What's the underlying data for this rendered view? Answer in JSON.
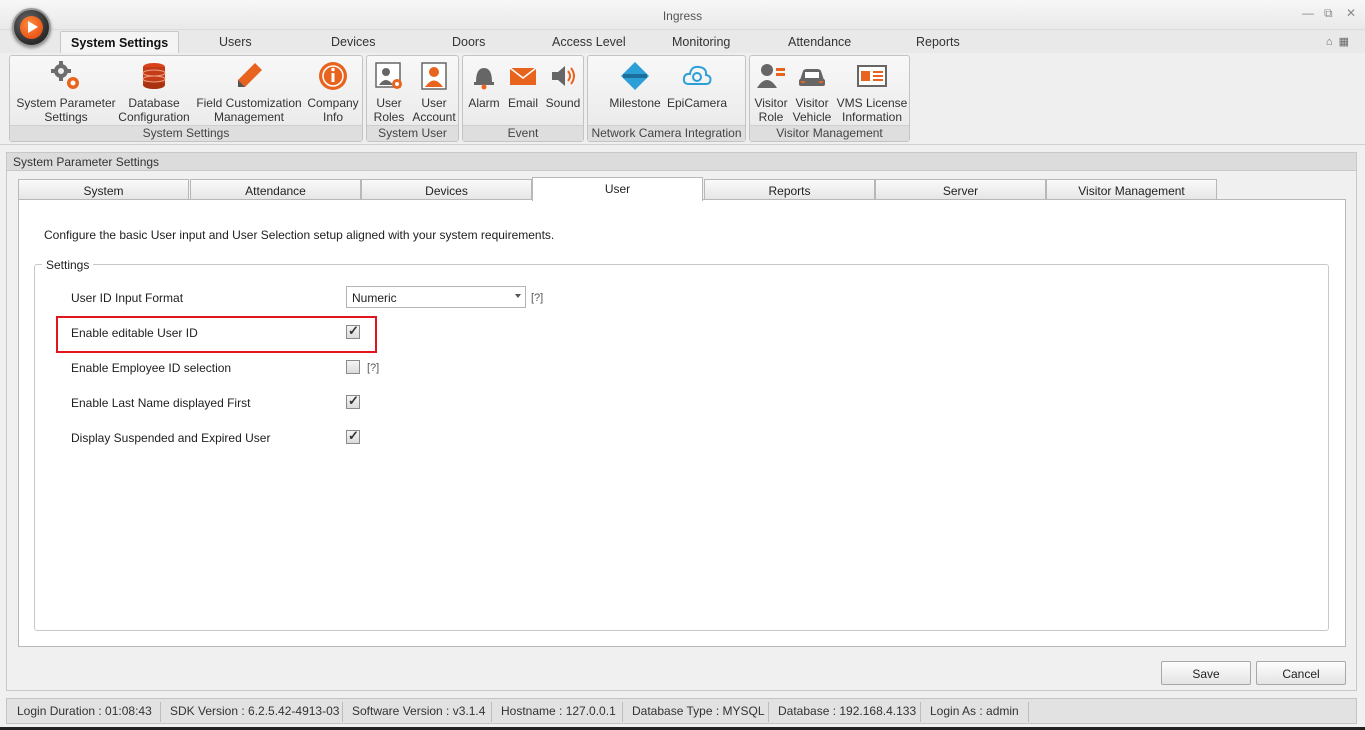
{
  "window": {
    "title": "Ingress",
    "controls": [
      "_",
      "▭",
      "▫"
    ]
  },
  "menu": {
    "tabs": [
      "System Settings",
      "Users",
      "Devices",
      "Doors",
      "Access Level",
      "Monitoring",
      "Attendance",
      "Reports"
    ],
    "active": "System Settings"
  },
  "ribbon": {
    "groups": [
      {
        "caption": "System Settings",
        "buttons": [
          {
            "label": "System Parameter\nSettings",
            "icon": "gears-icon"
          },
          {
            "label": "Database\nConfiguration",
            "icon": "database-icon"
          },
          {
            "label": "Field Customization\nManagement",
            "icon": "pencil-icon"
          },
          {
            "label": "Company\nInfo",
            "icon": "info-icon"
          }
        ]
      },
      {
        "caption": "System User",
        "buttons": [
          {
            "label": "User\nRoles",
            "icon": "user-roles-icon"
          },
          {
            "label": "User\nAccount",
            "icon": "user-account-icon"
          }
        ]
      },
      {
        "caption": "Event",
        "buttons": [
          {
            "label": "Alarm",
            "icon": "bell-icon"
          },
          {
            "label": "Email",
            "icon": "envelope-icon"
          },
          {
            "label": "Sound",
            "icon": "speaker-icon"
          }
        ]
      },
      {
        "caption": "Network Camera Integration",
        "buttons": [
          {
            "label": "Milestone",
            "icon": "milestone-icon"
          },
          {
            "label": "EpiCamera",
            "icon": "cloud-camera-icon"
          }
        ]
      },
      {
        "caption": "Visitor Management",
        "buttons": [
          {
            "label": "Visitor\nRole",
            "icon": "visitor-role-icon"
          },
          {
            "label": "Visitor\nVehicle",
            "icon": "car-icon"
          },
          {
            "label": "VMS License\nInformation",
            "icon": "license-card-icon"
          }
        ]
      }
    ]
  },
  "panel": {
    "title": "System Parameter Settings",
    "tabs": [
      "System",
      "Attendance",
      "Devices",
      "User",
      "Reports",
      "Server",
      "Visitor Management"
    ],
    "active_tab": "User",
    "description": "Configure the basic User input and User Selection setup aligned with your system requirements.",
    "settings_legend": "Settings",
    "fields": {
      "user_id_format": {
        "label": "User ID Input Format",
        "value": "Numeric",
        "help": "[?]"
      },
      "editable_user_id": {
        "label": "Enable editable User ID",
        "checked": true
      },
      "employee_id_selection": {
        "label": "Enable Employee ID selection",
        "checked": false,
        "help": "[?]"
      },
      "last_name_first": {
        "label": "Enable Last Name displayed First",
        "checked": true
      },
      "suspended_expired": {
        "label": "Display Suspended and Expired User",
        "checked": true
      }
    },
    "save_label": "Save",
    "cancel_label": "Cancel"
  },
  "status": {
    "login_duration": "Login Duration : 01:08:43",
    "sdk_version": "SDK Version : 6.2.5.42-4913-03",
    "software_version": "Software Version : v3.1.4",
    "hostname": "Hostname : 127.0.0.1",
    "database_type": "Database Type : MYSQL",
    "database": "Database : 192.168.4.133",
    "login_as": "Login As : admin"
  },
  "colors": {
    "accent_orange": "#e0420a",
    "highlight_red": "#e0151d"
  }
}
